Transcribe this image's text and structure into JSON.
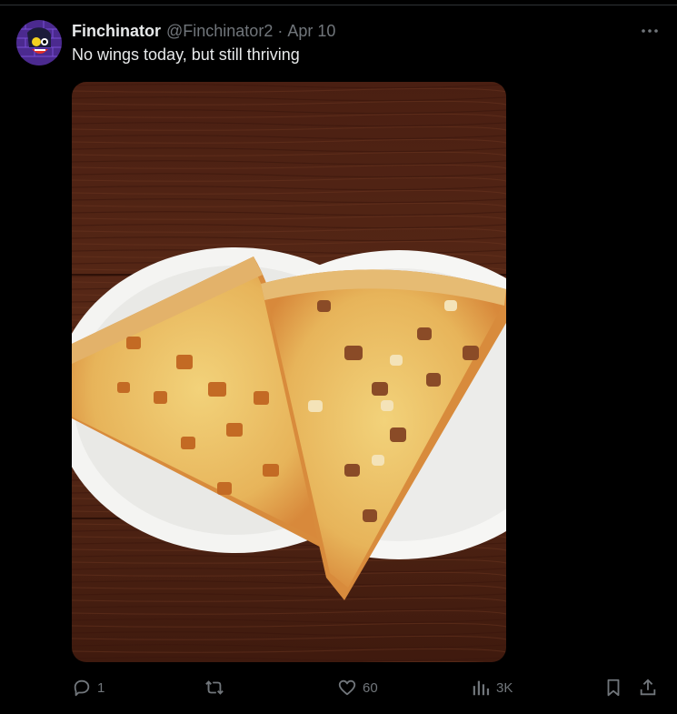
{
  "tweet": {
    "author_name": "Finchinator",
    "handle": "@Finchinator2",
    "separator": "·",
    "date": "Apr 10",
    "text": "No wings today, but still thriving"
  },
  "actions": {
    "replies": "1",
    "reposts": "",
    "likes": "60",
    "views": "3K"
  },
  "colors": {
    "background": "#000000",
    "text": "#e7e9ea",
    "muted": "#71767b",
    "divider": "#2f3336"
  },
  "icons": [
    "more-icon",
    "reply-icon",
    "repost-icon",
    "like-icon",
    "views-icon",
    "bookmark-icon",
    "share-icon"
  ]
}
